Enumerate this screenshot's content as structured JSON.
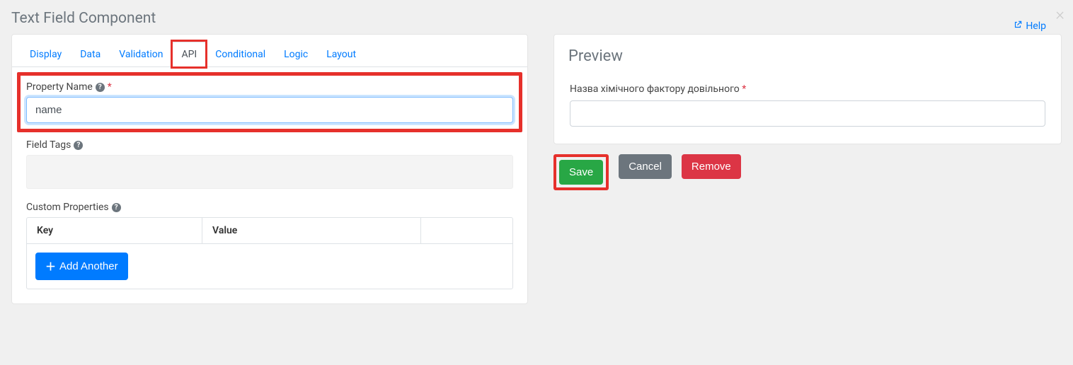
{
  "header": {
    "title": "Text Field Component",
    "help": "Help"
  },
  "tabs": {
    "display": "Display",
    "data": "Data",
    "validation": "Validation",
    "api": "API",
    "conditional": "Conditional",
    "logic": "Logic",
    "layout": "Layout"
  },
  "api": {
    "propertyName": {
      "label": "Property Name",
      "value": "name"
    },
    "fieldTags": {
      "label": "Field Tags"
    },
    "customProperties": {
      "label": "Custom Properties",
      "headers": {
        "key": "Key",
        "value": "Value"
      },
      "addAnother": "Add Another"
    }
  },
  "preview": {
    "title": "Preview",
    "fieldLabel": "Назва хімічного фактору довільного"
  },
  "actions": {
    "save": "Save",
    "cancel": "Cancel",
    "remove": "Remove"
  }
}
